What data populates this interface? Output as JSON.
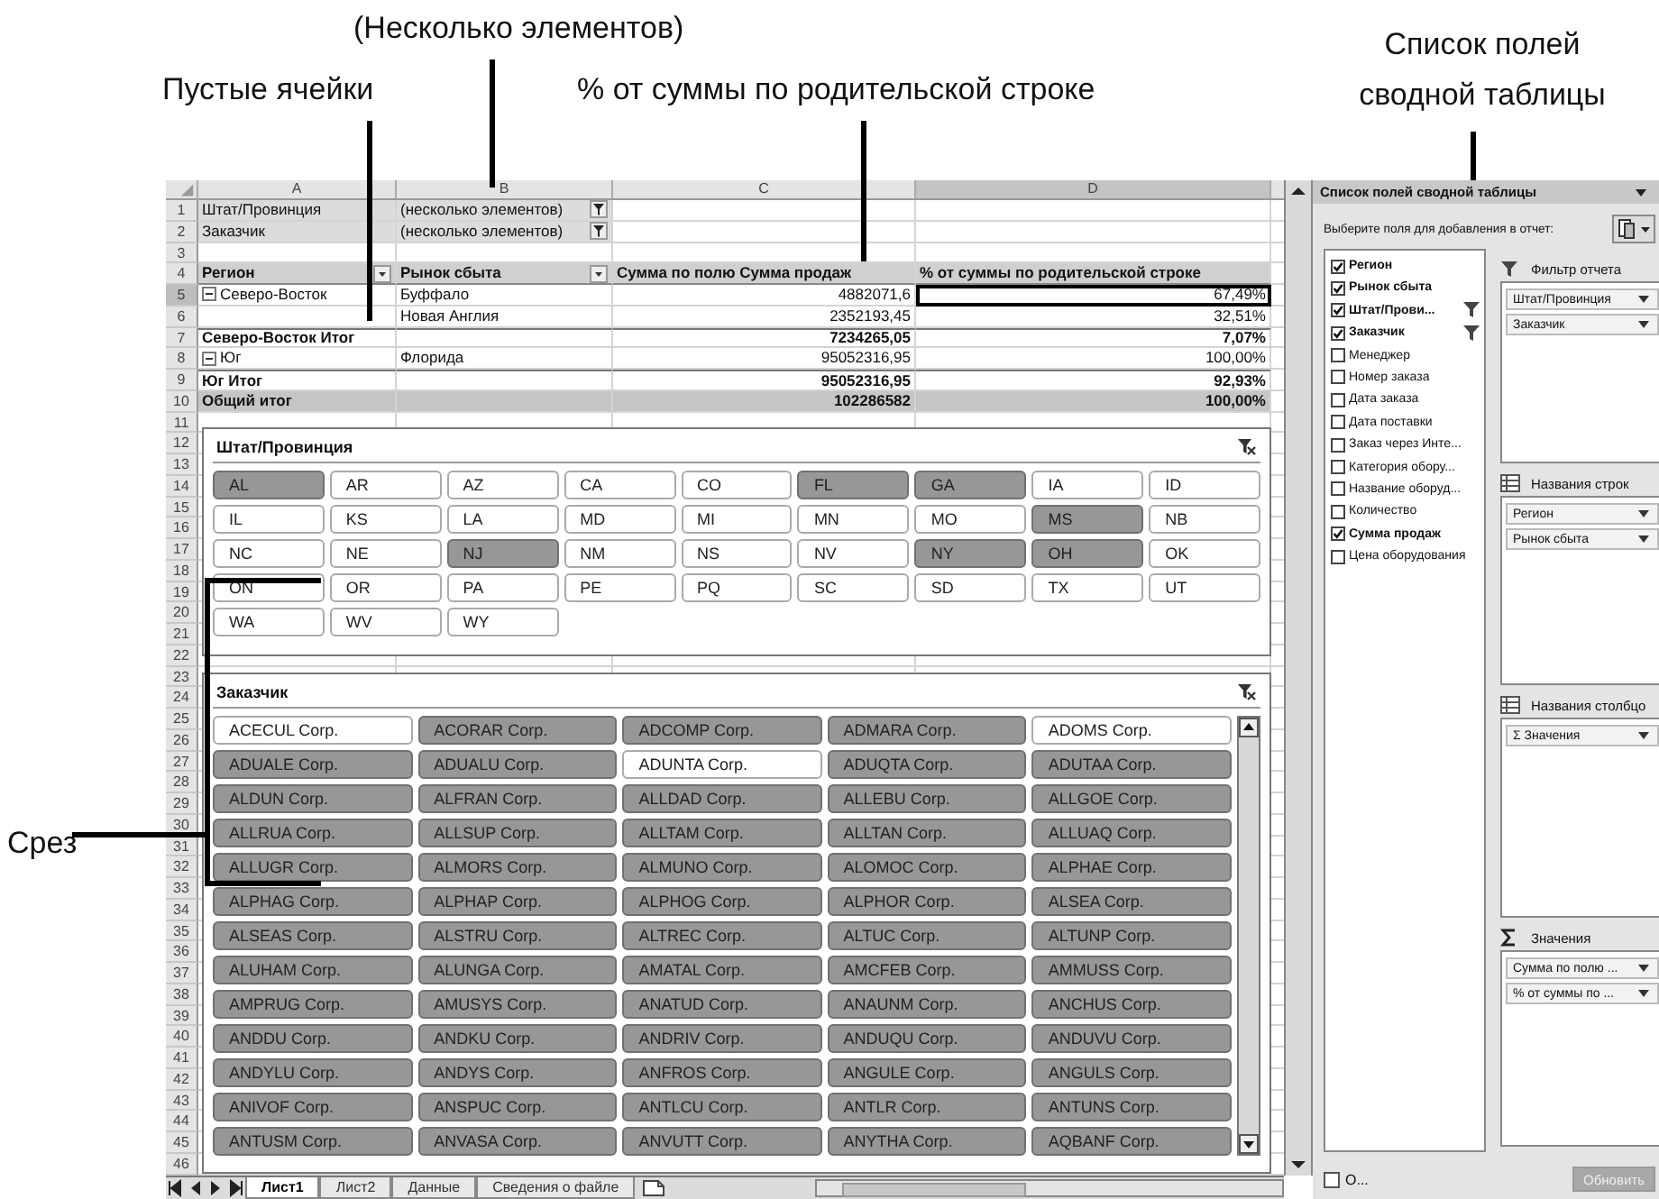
{
  "callouts": [
    {
      "text": "(Несколько элементов)"
    },
    {
      "text": "Пустые ячейки"
    },
    {
      "text": "% от суммы по родительской строке"
    },
    {
      "text": "Список полей сводной таблицы"
    },
    {
      "text": "Срез"
    }
  ],
  "sheet": {
    "columns": [
      "A",
      "B",
      "C",
      "D"
    ],
    "rows": [
      {
        "number": "1",
        "kind": "filter",
        "cells": [
          {
            "text": "Штат/Провинция",
            "selected": false
          },
          {
            "text": "(несколько элементов)",
            "filter_button": true,
            "selected": false
          },
          {
            "selected": false
          },
          {
            "selected": false
          }
        ]
      },
      {
        "number": "2",
        "kind": "filter",
        "cells": [
          {
            "text": "Заказчик",
            "selected": false
          },
          {
            "text": "(несколько элементов)",
            "filter_button": true,
            "selected": false
          },
          {
            "selected": false
          },
          {
            "selected": false
          }
        ]
      },
      {
        "number": "3",
        "kind": "blank",
        "cells": [
          {
            "selected": false
          },
          {
            "selected": false
          },
          {
            "selected": false
          },
          {
            "selected": false
          }
        ]
      },
      {
        "number": "4",
        "kind": "header",
        "cells": [
          {
            "text": "Регион",
            "dropdown": true,
            "selected": false
          },
          {
            "text": "Рынок сбыта",
            "dropdown": true,
            "selected": false
          },
          {
            "text": "Сумма по полю Сумма продаж",
            "selected": false
          },
          {
            "text": "% от суммы по родительской строке",
            "selected": false
          }
        ]
      },
      {
        "number": "5",
        "kind": "item",
        "cells": [
          {
            "text": "Северо-Восток",
            "expanded": true,
            "selected": false
          },
          {
            "text": "Буффало",
            "selected": false
          },
          {
            "text": "4882071,6",
            "selected": false
          },
          {
            "text": "67,49%",
            "selected": true
          }
        ]
      },
      {
        "number": "6",
        "kind": "item",
        "cells": [
          {
            "selected": false
          },
          {
            "text": "Новая Англия",
            "selected": false
          },
          {
            "text": "2352193,45",
            "selected": false
          },
          {
            "text": "32,51%",
            "selected": false
          }
        ]
      },
      {
        "number": "7",
        "kind": "subtotal",
        "cells": [
          {
            "text": "Северо-Восток Итог",
            "selected": false
          },
          {
            "selected": false
          },
          {
            "text": "7234265,05",
            "selected": false
          },
          {
            "text": "7,07%",
            "selected": false
          }
        ]
      },
      {
        "number": "8",
        "kind": "item",
        "cells": [
          {
            "text": "Юг",
            "expanded": true,
            "selected": false
          },
          {
            "text": "Флорида",
            "selected": false
          },
          {
            "text": "95052316,95",
            "selected": false
          },
          {
            "text": "100,00%",
            "selected": false
          }
        ]
      },
      {
        "number": "9",
        "kind": "subtotal",
        "cells": [
          {
            "text": "Юг Итог",
            "selected": false
          },
          {
            "selected": false
          },
          {
            "text": "95052316,95",
            "selected": false
          },
          {
            "text": "92,93%",
            "selected": false
          }
        ]
      },
      {
        "number": "10",
        "kind": "grand",
        "cells": [
          {
            "text": "Общий итог",
            "selected": false
          },
          {
            "selected": false
          },
          {
            "text": "102286582",
            "selected": false
          },
          {
            "text": "100,00%",
            "selected": false
          }
        ]
      }
    ],
    "more_row_numbers": [
      "11",
      "12",
      "13",
      "14",
      "15",
      "16",
      "17",
      "18",
      "19",
      "20",
      "21",
      "22",
      "23",
      "24",
      "25",
      "26",
      "27",
      "28",
      "29",
      "30",
      "31",
      "32",
      "33",
      "34",
      "35",
      "36",
      "37",
      "38",
      "39",
      "40",
      "41",
      "42",
      "43",
      "44",
      "45",
      "46"
    ],
    "tabs": [
      {
        "label": "Лист1",
        "selected": true
      },
      {
        "label": "Лист2",
        "selected": false
      },
      {
        "label": "Данные",
        "selected": false
      },
      {
        "label": "Сведения о файле",
        "selected": false
      }
    ]
  },
  "slicers": [
    {
      "title": "Штат/Провинция",
      "items": [
        {
          "label": "AL",
          "selected": true
        },
        {
          "label": "AR",
          "selected": false
        },
        {
          "label": "AZ",
          "selected": false
        },
        {
          "label": "CA",
          "selected": false
        },
        {
          "label": "CO",
          "selected": false
        },
        {
          "label": "FL",
          "selected": true
        },
        {
          "label": "GA",
          "selected": true
        },
        {
          "label": "IA",
          "selected": false
        },
        {
          "label": "ID",
          "selected": false
        },
        {
          "label": "IL",
          "selected": false
        },
        {
          "label": "KS",
          "selected": false
        },
        {
          "label": "LA",
          "selected": false
        },
        {
          "label": "MD",
          "selected": false
        },
        {
          "label": "MI",
          "selected": false
        },
        {
          "label": "MN",
          "selected": false
        },
        {
          "label": "MO",
          "selected": false
        },
        {
          "label": "MS",
          "selected": true
        },
        {
          "label": "NB",
          "selected": false
        },
        {
          "label": "NC",
          "selected": false
        },
        {
          "label": "NE",
          "selected": false
        },
        {
          "label": "NJ",
          "selected": true
        },
        {
          "label": "NM",
          "selected": false
        },
        {
          "label": "NS",
          "selected": false
        },
        {
          "label": "NV",
          "selected": false
        },
        {
          "label": "NY",
          "selected": true
        },
        {
          "label": "OH",
          "selected": true
        },
        {
          "label": "OK",
          "selected": false
        },
        {
          "label": "ON",
          "selected": false
        },
        {
          "label": "OR",
          "selected": false
        },
        {
          "label": "PA",
          "selected": false
        },
        {
          "label": "PE",
          "selected": false
        },
        {
          "label": "PQ",
          "selected": false
        },
        {
          "label": "SC",
          "selected": false
        },
        {
          "label": "SD",
          "selected": false
        },
        {
          "label": "TX",
          "selected": false
        },
        {
          "label": "UT",
          "selected": false
        },
        {
          "label": "WA",
          "selected": false
        },
        {
          "label": "WV",
          "selected": false
        },
        {
          "label": "WY",
          "selected": false
        }
      ]
    },
    {
      "title": "Заказчик",
      "items": [
        {
          "label": "ACECUL Corp.",
          "selected": false
        },
        {
          "label": "ACORAR Corp.",
          "selected": true
        },
        {
          "label": "ADCOMP Corp.",
          "selected": true
        },
        {
          "label": "ADMARA Corp.",
          "selected": true
        },
        {
          "label": "ADOMS Corp.",
          "selected": false
        },
        {
          "label": "ADUALE Corp.",
          "selected": true
        },
        {
          "label": "ADUALU Corp.",
          "selected": true
        },
        {
          "label": "ADUNTA Corp.",
          "selected": false
        },
        {
          "label": "ADUQTA Corp.",
          "selected": true
        },
        {
          "label": "ADUTAA Corp.",
          "selected": true
        },
        {
          "label": "ALDUN Corp.",
          "selected": true
        },
        {
          "label": "ALFRAN Corp.",
          "selected": true
        },
        {
          "label": "ALLDAD Corp.",
          "selected": true
        },
        {
          "label": "ALLEBU Corp.",
          "selected": true
        },
        {
          "label": "ALLGOE Corp.",
          "selected": true
        },
        {
          "label": "ALLRUA Corp.",
          "selected": true
        },
        {
          "label": "ALLSUP Corp.",
          "selected": true
        },
        {
          "label": "ALLTAM Corp.",
          "selected": true
        },
        {
          "label": "ALLTAN Corp.",
          "selected": true
        },
        {
          "label": "ALLUAQ Corp.",
          "selected": true
        },
        {
          "label": "ALLUGR Corp.",
          "selected": true
        },
        {
          "label": "ALMORS Corp.",
          "selected": true
        },
        {
          "label": "ALMUNO Corp.",
          "selected": true
        },
        {
          "label": "ALOMOC Corp.",
          "selected": true
        },
        {
          "label": "ALPHAE Corp.",
          "selected": true
        },
        {
          "label": "ALPHAG Corp.",
          "selected": true
        },
        {
          "label": "ALPHAP Corp.",
          "selected": true
        },
        {
          "label": "ALPHOG Corp.",
          "selected": true
        },
        {
          "label": "ALPHOR Corp.",
          "selected": true
        },
        {
          "label": "ALSEA Corp.",
          "selected": true
        },
        {
          "label": "ALSEAS Corp.",
          "selected": true
        },
        {
          "label": "ALSTRU Corp.",
          "selected": true
        },
        {
          "label": "ALTREC Corp.",
          "selected": true
        },
        {
          "label": "ALTUC Corp.",
          "selected": true
        },
        {
          "label": "ALTUNP Corp.",
          "selected": true
        },
        {
          "label": "ALUHAM Corp.",
          "selected": true
        },
        {
          "label": "ALUNGA Corp.",
          "selected": true
        },
        {
          "label": "AMATAL Corp.",
          "selected": true
        },
        {
          "label": "AMCFEB Corp.",
          "selected": true
        },
        {
          "label": "AMMUSS Corp.",
          "selected": true
        },
        {
          "label": "AMPRUG Corp.",
          "selected": true
        },
        {
          "label": "AMUSYS Corp.",
          "selected": true
        },
        {
          "label": "ANATUD Corp.",
          "selected": true
        },
        {
          "label": "ANAUNM Corp.",
          "selected": true
        },
        {
          "label": "ANCHUS Corp.",
          "selected": true
        },
        {
          "label": "ANDDU Corp.",
          "selected": true
        },
        {
          "label": "ANDKU Corp.",
          "selected": true
        },
        {
          "label": "ANDRIV Corp.",
          "selected": true
        },
        {
          "label": "ANDUQU Corp.",
          "selected": true
        },
        {
          "label": "ANDUVU Corp.",
          "selected": true
        },
        {
          "label": "ANDYLU Corp.",
          "selected": true
        },
        {
          "label": "ANDYS Corp.",
          "selected": true
        },
        {
          "label": "ANFROS Corp.",
          "selected": true
        },
        {
          "label": "ANGULE Corp.",
          "selected": true
        },
        {
          "label": "ANGULS Corp.",
          "selected": true
        },
        {
          "label": "ANIVOF Corp.",
          "selected": true
        },
        {
          "label": "ANSPUC Corp.",
          "selected": true
        },
        {
          "label": "ANTLCU Corp.",
          "selected": true
        },
        {
          "label": "ANTLR Corp.",
          "selected": true
        },
        {
          "label": "ANTUNS Corp.",
          "selected": true
        },
        {
          "label": "ANTUSM Corp.",
          "selected": true
        },
        {
          "label": "ANVASA Corp.",
          "selected": true
        },
        {
          "label": "ANVUTT Corp.",
          "selected": true
        },
        {
          "label": "ANYTHA Corp.",
          "selected": true
        },
        {
          "label": "AQBANF Corp.",
          "selected": true
        }
      ]
    }
  ],
  "field_list": {
    "title": "Список полей сводной таблицы",
    "prompt": "Выберите поля для добавления в отчет:",
    "fields": [
      {
        "label": "Регион",
        "checked": true,
        "filtered": false
      },
      {
        "label": "Рынок сбыта",
        "checked": true,
        "filtered": false
      },
      {
        "label": "Штат/Прови...",
        "checked": true,
        "filtered": true
      },
      {
        "label": "Заказчик",
        "checked": true,
        "filtered": true
      },
      {
        "label": "Менеджер",
        "checked": false,
        "filtered": false
      },
      {
        "label": "Номер заказа",
        "checked": false,
        "filtered": false
      },
      {
        "label": "Дата заказа",
        "checked": false,
        "filtered": false
      },
      {
        "label": "Дата поставки",
        "checked": false,
        "filtered": false
      },
      {
        "label": "Заказ через Инте...",
        "checked": false,
        "filtered": false
      },
      {
        "label": "Категория обору...",
        "checked": false,
        "filtered": false
      },
      {
        "label": "Название оборуд...",
        "checked": false,
        "filtered": false
      },
      {
        "label": "Количество",
        "checked": false,
        "filtered": false
      },
      {
        "label": "Сумма продаж",
        "checked": true,
        "filtered": false
      },
      {
        "label": "Цена оборудования",
        "checked": false,
        "filtered": false
      }
    ],
    "areas": [
      {
        "kind": "filter",
        "title": "Фильтр отчета",
        "items": [
          "Штат/Провинция",
          "Заказчик"
        ]
      },
      {
        "kind": "rows",
        "title": "Названия строк",
        "items": [
          "Регион",
          "Рынок сбыта"
        ]
      },
      {
        "kind": "columns",
        "title": "Названия столбцо",
        "items": [
          "Σ Значения"
        ]
      },
      {
        "kind": "values",
        "title": "Значения",
        "items": [
          "Сумма по полю ...",
          "% от суммы по ..."
        ]
      }
    ],
    "defer": {
      "label": "О...",
      "checked": false
    },
    "update_button": {
      "label": "Обновить",
      "disabled": true
    }
  }
}
